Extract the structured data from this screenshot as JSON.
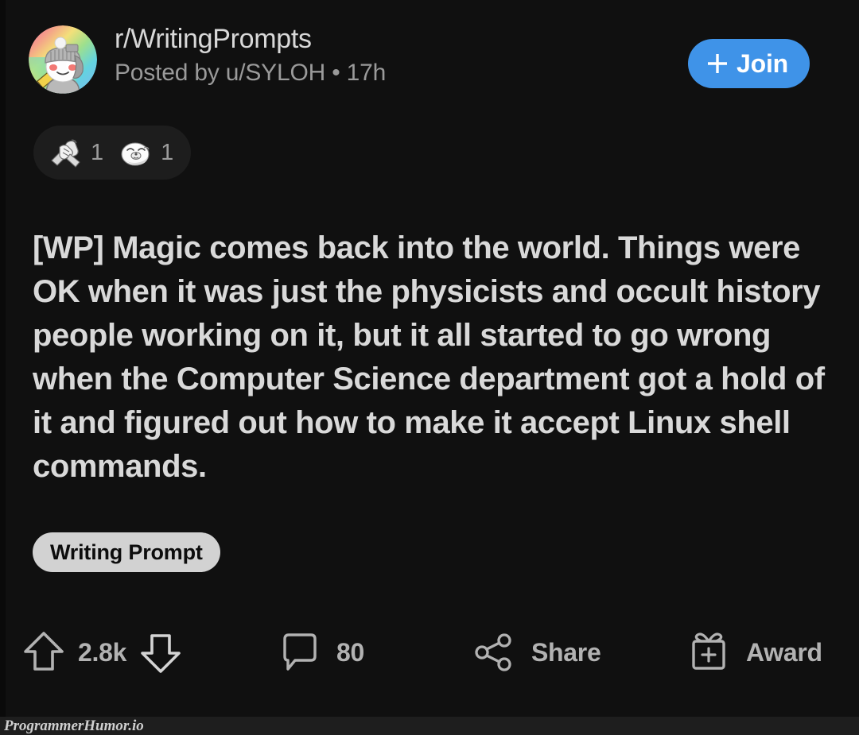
{
  "post": {
    "subreddit": "r/WritingPrompts",
    "byline": "Posted by u/SYLOH • 17h",
    "join_label": "Join",
    "title": "[WP] Magic comes back into the world. Things were OK when it was just the physicists and occult history people working on it, but it all started to go wrong when the Computer Science department got a hold of it and figured out how to make it accept Linux shell commands.",
    "flair": "Writing Prompt",
    "awards": [
      {
        "icon": "clasped-hands-award-icon",
        "count": "1"
      },
      {
        "icon": "seal-award-icon",
        "count": "1"
      }
    ],
    "actions": {
      "upvote_count": "2.8k",
      "comment_count": "80",
      "share_label": "Share",
      "award_label": "Award"
    }
  },
  "watermark": "ProgrammerHumor.io",
  "colors": {
    "background": "#101010",
    "join_blue": "#3f93e8",
    "flair_bg": "#d2d2d2",
    "text_primary": "#d9d9d9",
    "text_secondary": "#9a9a9a",
    "action_text": "#b2b2b2",
    "awards_pill": "#1d1d1d"
  }
}
